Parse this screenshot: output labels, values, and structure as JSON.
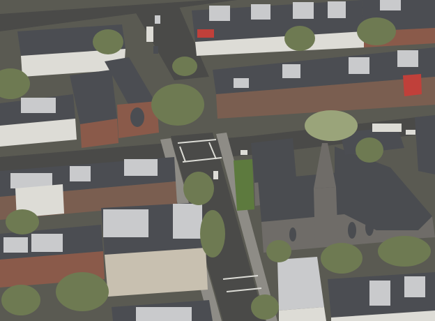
{
  "scene": {
    "kind": "aerial-photograph",
    "colors": {
      "ground": "#5a5a52",
      "road": "#4a4a48",
      "sidewalk": "#8e8c86",
      "lane_marking": "#dcdcd6",
      "roof_dark": "#4b4d52",
      "roof_light": "#c9cacc",
      "brick": "#8a5a4a",
      "brownstone": "#7a5e50",
      "limestone": "#c8c0b0",
      "white_facade": "#dddcd6",
      "church_stone": "#6f6c68",
      "church_roof": "#4a4c50",
      "tree": "#6e7a52",
      "tree_light": "#9aa47a",
      "lawn": "#5d7a3e",
      "red_roof": "#c0403a"
    }
  }
}
